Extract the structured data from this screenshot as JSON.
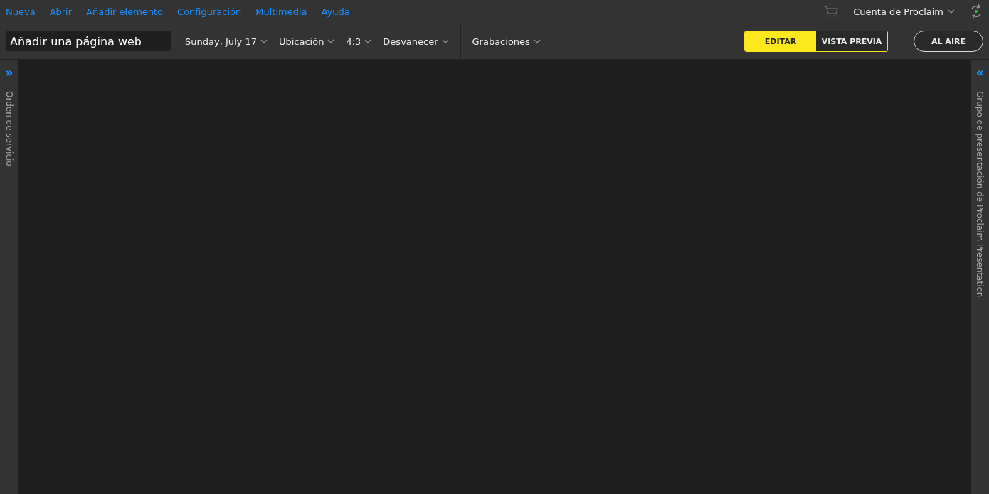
{
  "menu": [
    "Nueva",
    "Abrir",
    "Añadir elemento",
    "Configuración",
    "Multimedia",
    "Ayuda"
  ],
  "account": {
    "label": "Cuenta de Proclaim"
  },
  "toolbar": {
    "title_field": "Añadir una página web",
    "dropdowns": [
      "Sunday, July 17",
      "Ubicación",
      "4:3",
      "Desvanecer"
    ],
    "recordings": "Grabaciones",
    "modes": [
      {
        "label": "EDITAR",
        "selected": true
      },
      {
        "label": "VISTA PREVIA",
        "selected": false
      }
    ],
    "on_air": "AL AIRE"
  },
  "left_panel": {
    "toggle": "»",
    "label": "Orden de servicio"
  },
  "right_panel": {
    "toggle": "«",
    "label": "Grupo de presentación de Proclaim Presentation"
  }
}
